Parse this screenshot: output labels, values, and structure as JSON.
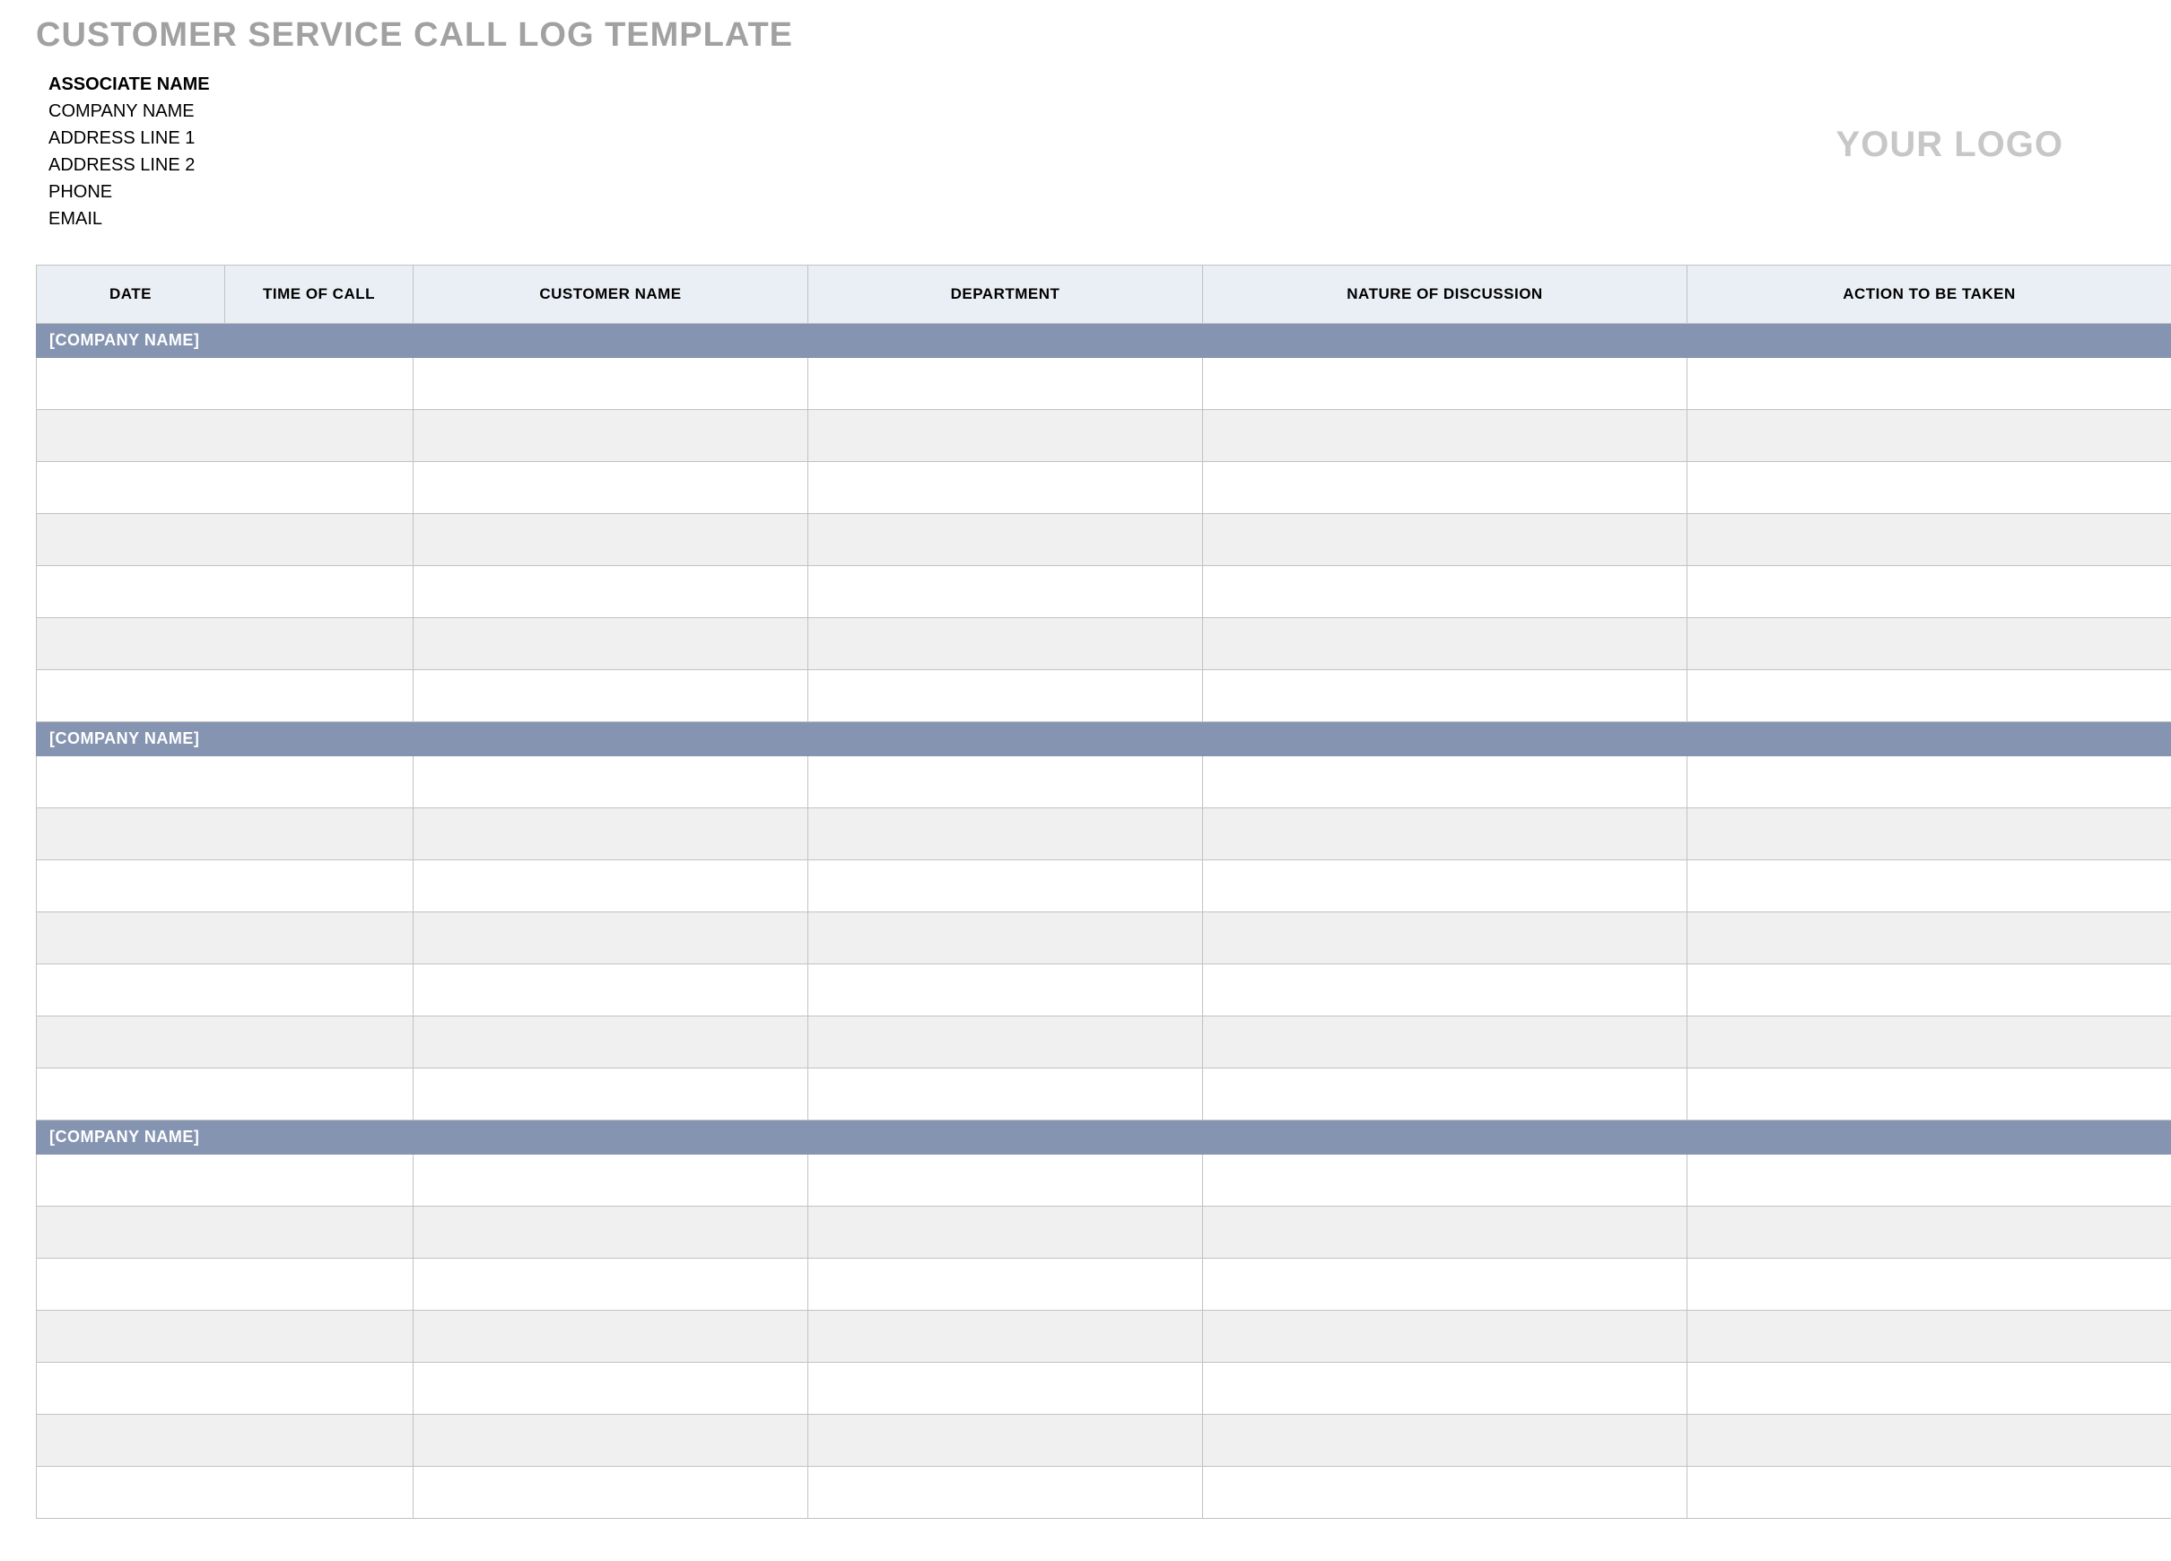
{
  "title": "CUSTOMER SERVICE CALL LOG TEMPLATE",
  "header": {
    "associateLabel": "ASSOCIATE NAME",
    "lines": [
      "COMPANY NAME",
      "ADDRESS LINE 1",
      "ADDRESS LINE 2",
      "PHONE",
      "EMAIL"
    ]
  },
  "logoText": "YOUR LOGO",
  "columns": [
    "DATE",
    "TIME OF CALL",
    "CUSTOMER NAME",
    "DEPARTMENT",
    "NATURE OF DISCUSSION",
    "ACTION TO BE TAKEN"
  ],
  "sections": [
    {
      "label": "[COMPANY NAME]",
      "rows": [
        {
          "date": "",
          "time": "",
          "customer": "",
          "dept": "",
          "nature": "",
          "action": ""
        },
        {
          "date": "",
          "time": "",
          "customer": "",
          "dept": "",
          "nature": "",
          "action": ""
        },
        {
          "date": "",
          "time": "",
          "customer": "",
          "dept": "",
          "nature": "",
          "action": ""
        },
        {
          "date": "",
          "time": "",
          "customer": "",
          "dept": "",
          "nature": "",
          "action": ""
        },
        {
          "date": "",
          "time": "",
          "customer": "",
          "dept": "",
          "nature": "",
          "action": ""
        },
        {
          "date": "",
          "time": "",
          "customer": "",
          "dept": "",
          "nature": "",
          "action": ""
        },
        {
          "date": "",
          "time": "",
          "customer": "",
          "dept": "",
          "nature": "",
          "action": ""
        }
      ]
    },
    {
      "label": "[COMPANY NAME]",
      "rows": [
        {
          "date": "",
          "time": "",
          "customer": "",
          "dept": "",
          "nature": "",
          "action": ""
        },
        {
          "date": "",
          "time": "",
          "customer": "",
          "dept": "",
          "nature": "",
          "action": ""
        },
        {
          "date": "",
          "time": "",
          "customer": "",
          "dept": "",
          "nature": "",
          "action": ""
        },
        {
          "date": "",
          "time": "",
          "customer": "",
          "dept": "",
          "nature": "",
          "action": ""
        },
        {
          "date": "",
          "time": "",
          "customer": "",
          "dept": "",
          "nature": "",
          "action": ""
        },
        {
          "date": "",
          "time": "",
          "customer": "",
          "dept": "",
          "nature": "",
          "action": ""
        },
        {
          "date": "",
          "time": "",
          "customer": "",
          "dept": "",
          "nature": "",
          "action": ""
        }
      ]
    },
    {
      "label": "[COMPANY NAME]",
      "rows": [
        {
          "date": "",
          "time": "",
          "customer": "",
          "dept": "",
          "nature": "",
          "action": ""
        },
        {
          "date": "",
          "time": "",
          "customer": "",
          "dept": "",
          "nature": "",
          "action": ""
        },
        {
          "date": "",
          "time": "",
          "customer": "",
          "dept": "",
          "nature": "",
          "action": ""
        },
        {
          "date": "",
          "time": "",
          "customer": "",
          "dept": "",
          "nature": "",
          "action": ""
        },
        {
          "date": "",
          "time": "",
          "customer": "",
          "dept": "",
          "nature": "",
          "action": ""
        },
        {
          "date": "",
          "time": "",
          "customer": "",
          "dept": "",
          "nature": "",
          "action": ""
        },
        {
          "date": "",
          "time": "",
          "customer": "",
          "dept": "",
          "nature": "",
          "action": ""
        }
      ]
    }
  ]
}
